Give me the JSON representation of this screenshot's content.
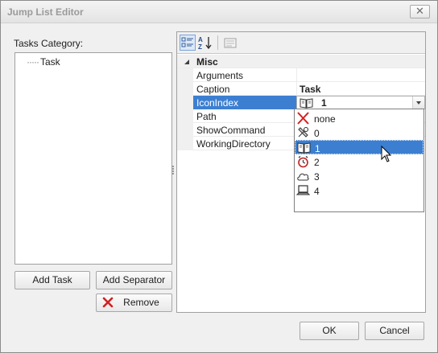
{
  "window": {
    "title": "Jump List Editor",
    "close_glyph": "✕"
  },
  "tasks": {
    "label": "Tasks Category:",
    "items": [
      {
        "label": "Task"
      }
    ]
  },
  "buttons": {
    "add_task": "Add Task",
    "add_separator": "Add Separator",
    "remove": "Remove",
    "ok": "OK",
    "cancel": "Cancel"
  },
  "property_grid": {
    "category": "Misc",
    "rows": [
      {
        "name": "Arguments",
        "value": ""
      },
      {
        "name": "Caption",
        "value": "Task"
      },
      {
        "name": "IconIndex",
        "value": "1"
      },
      {
        "name": "Path",
        "value": ""
      },
      {
        "name": "ShowCommand",
        "value": ""
      },
      {
        "name": "WorkingDirectory",
        "value": ""
      }
    ],
    "selected_row": "IconIndex"
  },
  "dropdown": {
    "options": [
      {
        "label": "none",
        "icon": "red-x-icon"
      },
      {
        "label": "0",
        "icon": "tools-icon"
      },
      {
        "label": "1",
        "icon": "book-icon",
        "highlighted": true
      },
      {
        "label": "2",
        "icon": "alarm-clock-icon"
      },
      {
        "label": "3",
        "icon": "cloud-icon"
      },
      {
        "label": "4",
        "icon": "laptop-icon"
      }
    ]
  },
  "colors": {
    "selection": "#3c7fd1",
    "window_bg": "#f0f0f0",
    "accent_red": "#d42020"
  }
}
